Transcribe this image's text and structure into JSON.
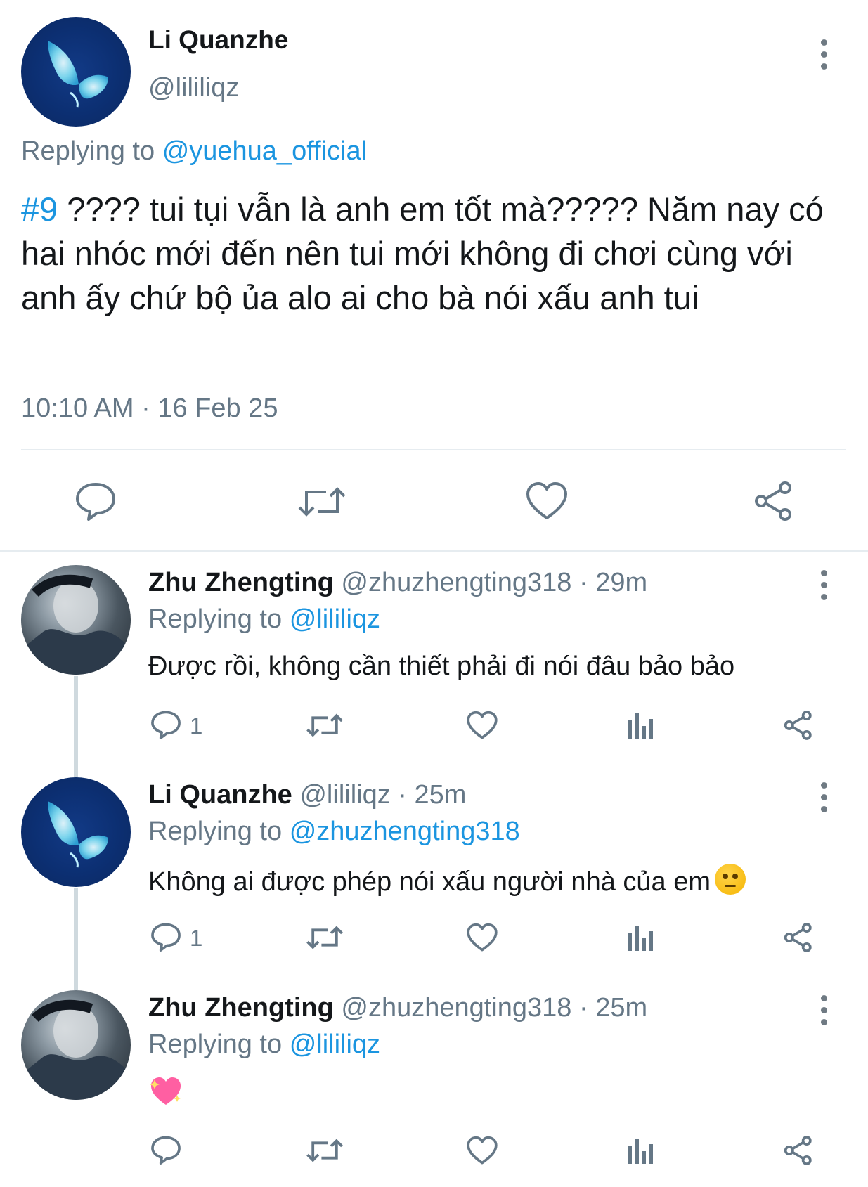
{
  "main_tweet": {
    "author_name": "Li Quanzhe",
    "author_handle": "@lililiqz",
    "replying_label": "Replying to",
    "replying_to": "@yuehua_official",
    "hashtag": "#9",
    "text": "???? tui tụi vẫn là anh em tốt mà????? Năm nay có hai nhóc mới đến nên tui mới không đi chơi cùng với anh ấy chứ bộ ủa alo ai cho bà nói xấu anh tui",
    "timestamp": "10:10 AM · 16 Feb 25",
    "actions": [
      "reply-icon",
      "retweet-icon",
      "like-icon",
      "share-icon"
    ]
  },
  "replies": [
    {
      "author_name": "Zhu Zhengting",
      "author_handle": "@zhuzhengting318",
      "time": "· 29m",
      "replying_label": "Replying to",
      "replying_to": "@lililiqz",
      "text": "Được rồi, không cần thiết phải đi nói đâu bảo bảo",
      "reply_count": "1"
    },
    {
      "author_name": "Li Quanzhe",
      "author_handle": "@lililiqz",
      "time": "· 25m",
      "replying_label": "Replying to",
      "replying_to": "@zhuzhengting318",
      "text": "Không ai được phép nói xấu người nhà của em",
      "emoji": "angry-face-emoji",
      "reply_count": "1"
    },
    {
      "author_name": "Zhu Zhengting",
      "author_handle": "@zhuzhengting318",
      "time": "· 25m",
      "replying_label": "Replying to",
      "replying_to": "@lililiqz",
      "text": "💖",
      "reply_count": ""
    }
  ],
  "colors": {
    "link": "#1b95e0",
    "secondary_text": "#657786",
    "primary_text": "#14171a",
    "divider": "#e6ecf0",
    "emoji_heart": "#ff5fa2"
  }
}
